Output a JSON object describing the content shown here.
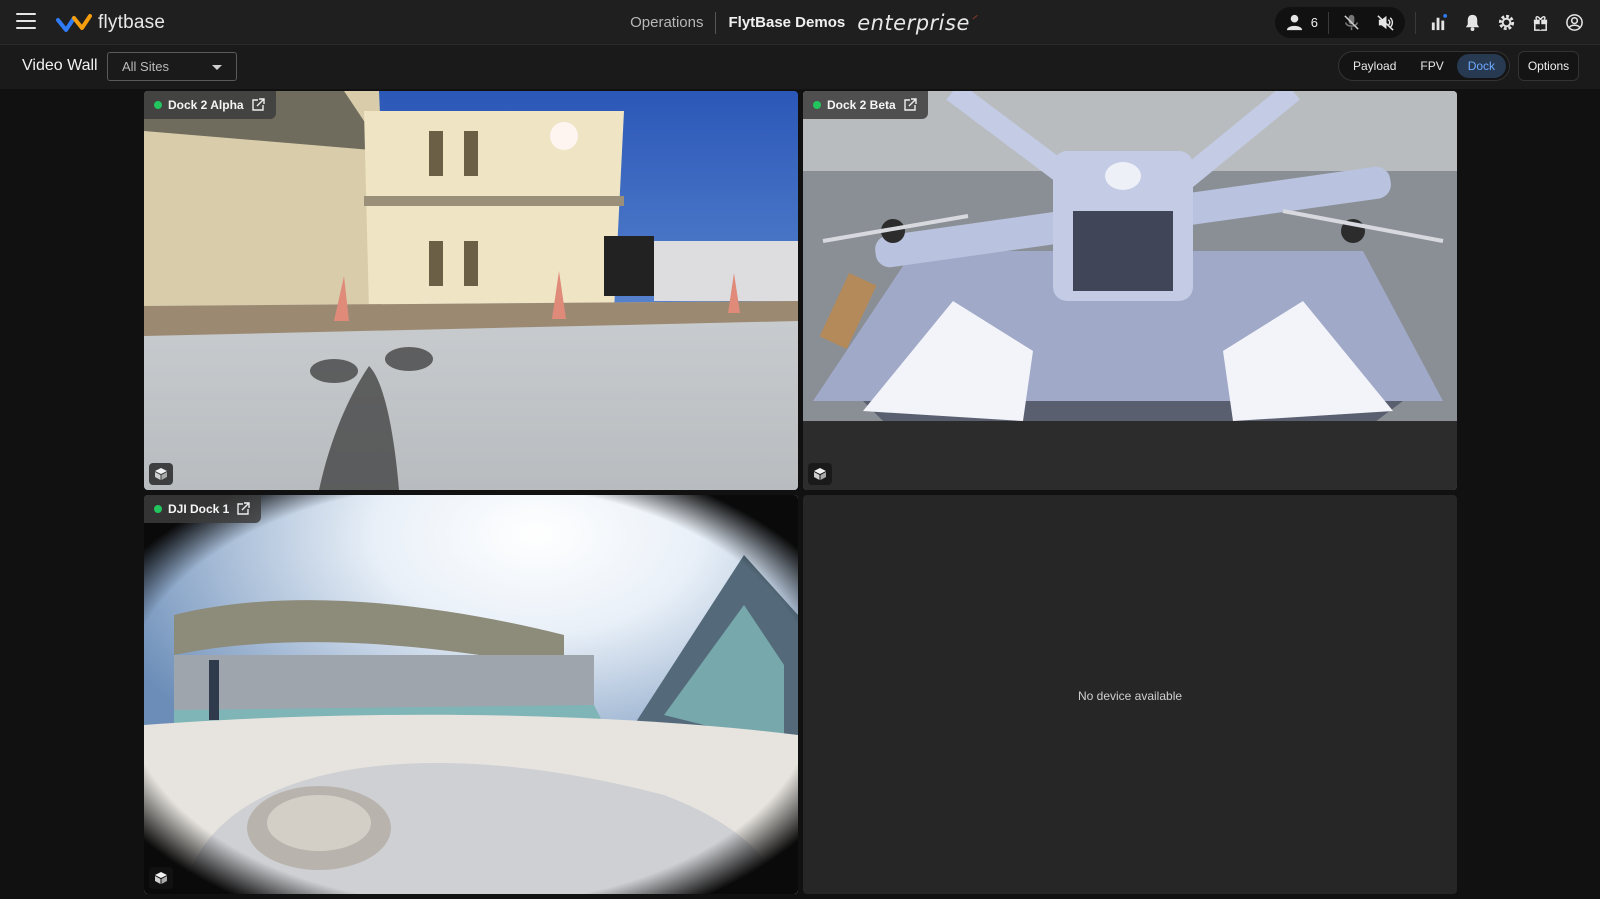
{
  "header": {
    "logo_text": "flytbase",
    "nav_operations": "Operations",
    "org_name": "FlytBase Demos",
    "edition": "enterprise",
    "users_count": "6",
    "icons": [
      "menu-icon",
      "users-icon",
      "mic-off-icon",
      "speaker-muted-icon",
      "analytics-icon",
      "bell-icon",
      "gear-icon",
      "gift-icon",
      "account-icon"
    ]
  },
  "subbar": {
    "title": "Video Wall",
    "site_filter": "All Sites",
    "view_modes": [
      "Payload",
      "FPV",
      "Dock"
    ],
    "active_mode": "Dock",
    "options_label": "Options"
  },
  "tiles": [
    {
      "name": "Dock 2 Alpha",
      "status": "online"
    },
    {
      "name": "Dock 2 Beta",
      "status": "online"
    },
    {
      "name": "DJI Dock 1",
      "status": "online"
    },
    {
      "empty_message": "No device available"
    }
  ],
  "colors": {
    "accent": "#6ea9ff",
    "status_online": "#22c55e",
    "brand_orange": "#e8542c",
    "brand_blue": "#2f7cf6"
  }
}
